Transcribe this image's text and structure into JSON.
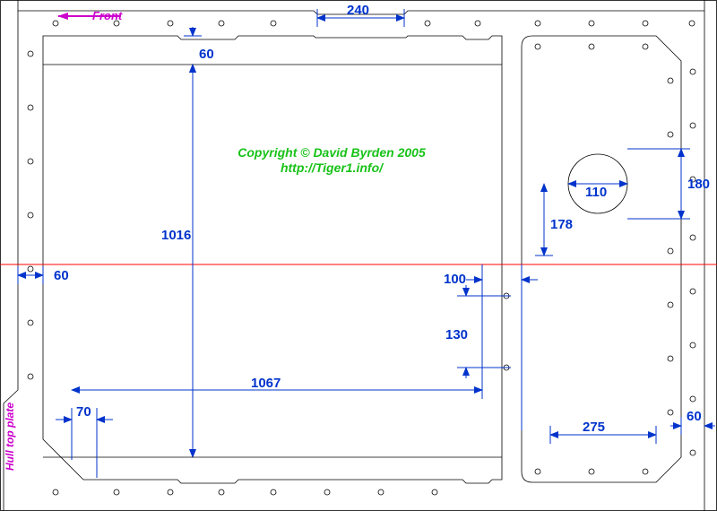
{
  "labels": {
    "front": "Front",
    "side_label": "Hull top plate",
    "copyright_line1": "Copyright © David Byrden 2005",
    "copyright_line2": "http://Tiger1.info/"
  },
  "dimensions": {
    "d240": "240",
    "d60_top": "60",
    "d1016": "1016",
    "d60_left": "60",
    "d70": "70",
    "d1067": "1067",
    "d100": "100",
    "d130": "130",
    "d178": "178",
    "d110": "110",
    "d180": "180",
    "d275": "275",
    "d60_right": "60"
  },
  "colors": {
    "dimension": "#0033cc",
    "label": "#cc00cc",
    "centerline": "#ff0000",
    "copyright": "#18c218"
  }
}
